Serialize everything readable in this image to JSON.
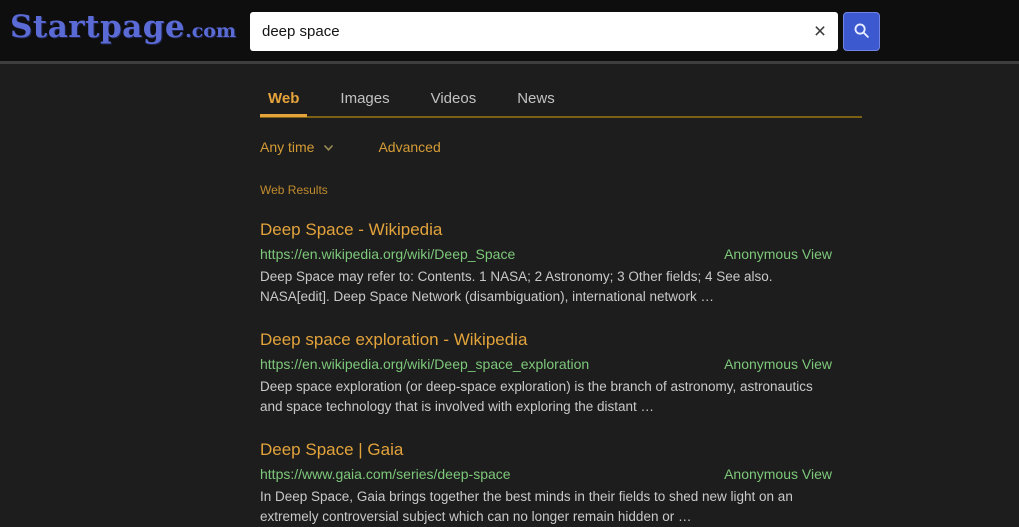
{
  "header": {
    "logo_brand": "Startpage",
    "logo_tld": ".com",
    "search_value": "deep space",
    "clear_icon": "×"
  },
  "tabs": [
    {
      "label": "Web",
      "active": true
    },
    {
      "label": "Images",
      "active": false
    },
    {
      "label": "Videos",
      "active": false
    },
    {
      "label": "News",
      "active": false
    }
  ],
  "filters": {
    "time_filter": "Any time",
    "advanced": "Advanced"
  },
  "results_heading": "Web Results",
  "results": [
    {
      "title": "Deep Space - Wikipedia",
      "url": "https://en.wikipedia.org/wiki/Deep_Space",
      "anonymous_view": "Anonymous View",
      "snippet": "Deep Space may refer to: Contents. 1 NASA; 2 Astronomy; 3 Other fields; 4 See also. NASA[edit]. Deep Space Network (disambiguation), international network …"
    },
    {
      "title": "Deep space exploration - Wikipedia",
      "url": "https://en.wikipedia.org/wiki/Deep_space_exploration",
      "anonymous_view": "Anonymous View",
      "snippet": "Deep space exploration (or deep-space exploration) is the branch of astronomy, astronautics and space technology that is involved with exploring the distant …"
    },
    {
      "title": "Deep Space | Gaia",
      "url": "https://www.gaia.com/series/deep-space",
      "anonymous_view": "Anonymous View",
      "snippet": "In Deep Space, Gaia brings together the best minds in their fields to shed new light on an extremely controversial subject which can no longer remain hidden or …"
    }
  ],
  "colors": {
    "accent_orange": "#e2a33b",
    "link_green": "#7dc87a",
    "brand_blue": "#5b6bd5",
    "button_blue": "#3d59d0"
  }
}
